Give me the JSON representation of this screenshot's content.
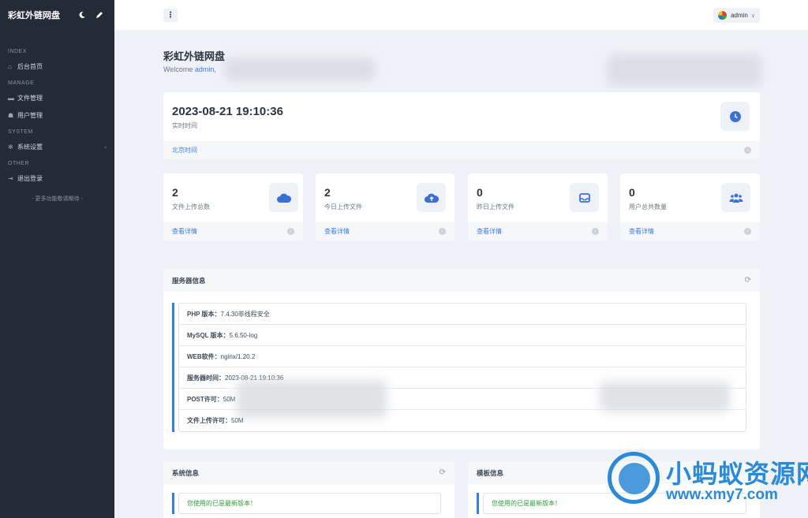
{
  "sidebar": {
    "brand": "彩虹外链网盘",
    "sections": [
      {
        "title": "INDEX",
        "items": [
          {
            "label": "后台首页",
            "icon": "home-icon"
          }
        ]
      },
      {
        "title": "MANAGE",
        "items": [
          {
            "label": "文件管理",
            "icon": "folder-icon"
          },
          {
            "label": "用户管理",
            "icon": "users-icon"
          }
        ]
      },
      {
        "title": "SYSTEM",
        "items": [
          {
            "label": "系统设置",
            "icon": "gear-icon"
          }
        ]
      },
      {
        "title": "OTHER",
        "items": [
          {
            "label": "退出登录",
            "icon": "logout-icon"
          }
        ]
      }
    ],
    "footer": "- 更多功能敬请期待 -"
  },
  "topbar": {
    "menu_icon": "⋮",
    "user": "admin"
  },
  "page": {
    "title": "彩虹外链网盘",
    "welcome_prefix": "Welcome ",
    "welcome_user": "admin",
    "welcome_suffix": ","
  },
  "time_card": {
    "value": "2023-08-21 19:10:36",
    "label": "实时时间",
    "footer": "北京时间"
  },
  "stats": [
    {
      "value": "2",
      "label": "文件上传总数",
      "footer": "查看详情",
      "icon": "cloud-icon"
    },
    {
      "value": "2",
      "label": "今日上传文件",
      "footer": "查看详情",
      "icon": "cloud-upload-icon"
    },
    {
      "value": "0",
      "label": "昨日上传文件",
      "footer": "查看详情",
      "icon": "inbox-icon"
    },
    {
      "value": "0",
      "label": "用户总共数量",
      "footer": "查看详情",
      "icon": "users-icon"
    }
  ],
  "server_info": {
    "title": "服务器信息",
    "rows": [
      {
        "key": "PHP 版本：",
        "value": "7.4.30非线程安全"
      },
      {
        "key": "MySQL 版本：",
        "value": "5.6.50-log"
      },
      {
        "key": "WEB软件：",
        "value": "nginx/1.20.2"
      },
      {
        "key": "服务器时间：",
        "value": "2023-08-21 19:10:36"
      },
      {
        "key": "POST许可：",
        "value": "50M"
      },
      {
        "key": "文件上传许可：",
        "value": "50M"
      }
    ]
  },
  "system_info": {
    "title": "系统信息",
    "message": "您使用的已是最新版本！"
  },
  "template_info": {
    "title": "模板信息",
    "message": "您使用的已是最新版本！"
  },
  "watermark": {
    "line1": "小蚂蚁资源网",
    "line2": "www.xmy7.com"
  },
  "colors": {
    "sidebar_bg": "#232b36",
    "accent": "#3b7ddd",
    "success": "#2e9b3b"
  }
}
